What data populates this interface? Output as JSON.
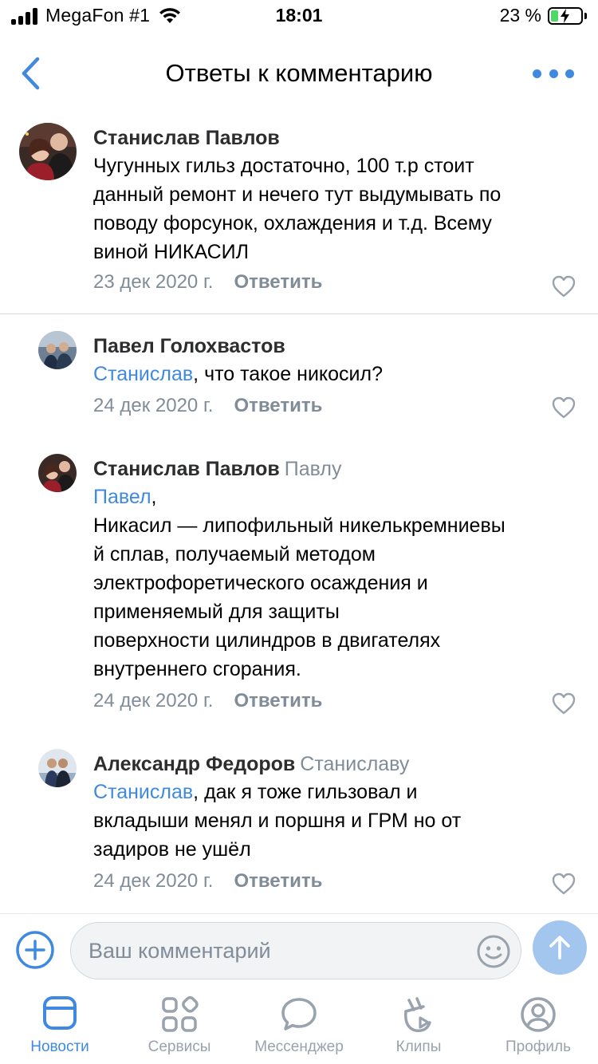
{
  "status_bar": {
    "carrier": "MegaFon #1",
    "time": "18:01",
    "battery": "23 %"
  },
  "header": {
    "title": "Ответы к комментарию"
  },
  "comments": [
    {
      "author": "Станислав Павлов",
      "reply_to": "",
      "mention": "",
      "text_lines": [
        "Чугунных гильз достаточно, 100 т.р стоит",
        "данный ремонт и нечего тут выдумывать по",
        "поводу форсунок, охлаждения и т.д. Всему",
        "виной НИКАСИЛ"
      ],
      "date": "23 дек 2020 г.",
      "reply_label": "Ответить"
    },
    {
      "author": "Павел Голохвастов",
      "reply_to": "",
      "mention": "Станислав",
      "text_lines": [
        ", что такое никосил?"
      ],
      "date": "24 дек 2020 г.",
      "reply_label": "Ответить"
    },
    {
      "author": "Станислав Павлов",
      "reply_to": "Павлу",
      "mention": "Павел",
      "text_lines": [
        ",",
        "Никасил — липофильный никелькремниевы",
        "й сплав, получаемый методом",
        "электрофоретического осаждения и",
        "применяемый для защиты",
        "поверхности цилиндров в двигателях",
        "внутреннего сгорания."
      ],
      "date": "24 дек 2020 г.",
      "reply_label": "Ответить"
    },
    {
      "author": "Александр Федоров",
      "reply_to": "Станиславу",
      "mention": "Станислав",
      "text_lines": [
        ", дак я тоже гильзовал и",
        "вкладыши менял и поршня и ГРМ но от",
        "задиров не ушёл"
      ],
      "date": "24 дек 2020 г.",
      "reply_label": "Ответить"
    }
  ],
  "input": {
    "placeholder": "Ваш комментарий",
    "value": ""
  },
  "tabs": [
    {
      "label": "Новости",
      "icon": "news-icon",
      "active": true
    },
    {
      "label": "Сервисы",
      "icon": "services-icon",
      "active": false
    },
    {
      "label": "Мессенджер",
      "icon": "messenger-icon",
      "active": false
    },
    {
      "label": "Клипы",
      "icon": "clips-icon",
      "active": false
    },
    {
      "label": "Профиль",
      "icon": "profile-icon",
      "active": false
    }
  ],
  "colors": {
    "accent": "#3f8ae0",
    "secondary_text": "#818c99",
    "send_button": "#a3c6ef",
    "tab_inactive": "#99a2ad"
  }
}
